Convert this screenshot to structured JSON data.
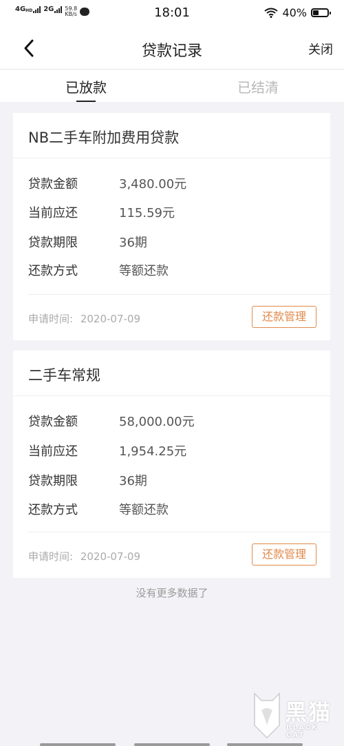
{
  "status_bar": {
    "network_1": "4G",
    "network_1_sup": "HD",
    "network_2": "2G",
    "speed_value": "59.8",
    "speed_unit": "KB/s",
    "time": "18:01",
    "battery_text": "40%",
    "battery_level": 0.4
  },
  "nav": {
    "title": "贷款记录",
    "close_label": "关闭",
    "back_icon": "chevron-left-icon"
  },
  "tabs": [
    {
      "label": "已放款",
      "active": true
    },
    {
      "label": "已结清",
      "active": false
    }
  ],
  "loans": [
    {
      "title": "NB二手车附加费用贷款",
      "rows": [
        {
          "label": "贷款金额",
          "value": "3,480.00元"
        },
        {
          "label": "当前应还",
          "value": "115.59元"
        },
        {
          "label": "贷款期限",
          "value": "36期"
        },
        {
          "label": "还款方式",
          "value": "等额还款"
        }
      ],
      "apply_label": "申请时间:",
      "apply_date": "2020-07-09",
      "button_label": "还款管理"
    },
    {
      "title": "二手车常规",
      "rows": [
        {
          "label": "贷款金额",
          "value": "58,000.00元"
        },
        {
          "label": "当前应还",
          "value": "1,954.25元"
        },
        {
          "label": "贷款期限",
          "value": "36期"
        },
        {
          "label": "还款方式",
          "value": "等额还款"
        }
      ],
      "apply_label": "申请时间:",
      "apply_date": "2020-07-09",
      "button_label": "还款管理"
    }
  ],
  "footer_text": "没有更多数据了",
  "watermark": {
    "main": "黑猫",
    "sub": "BLACK CAT"
  },
  "colors": {
    "accent": "#e0894a",
    "background": "#f3f3f7",
    "inactive_tab": "#b8b8b8"
  }
}
